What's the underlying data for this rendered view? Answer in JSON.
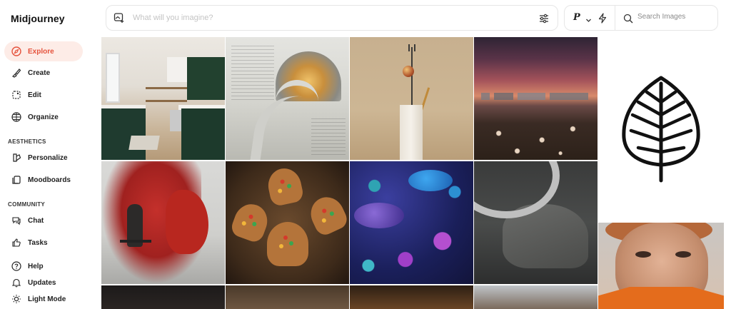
{
  "app": {
    "brand": "Midjourney"
  },
  "sidebar": {
    "items": [
      {
        "label": "Explore",
        "icon": "compass-icon",
        "active": true
      },
      {
        "label": "Create",
        "icon": "brush-icon"
      },
      {
        "label": "Edit",
        "icon": "edit-icon"
      },
      {
        "label": "Organize",
        "icon": "grid-icon"
      }
    ],
    "aesthetics_label": "AESTHETICS",
    "aesthetics_items": [
      {
        "label": "Personalize",
        "icon": "palette-icon"
      },
      {
        "label": "Moodboards",
        "icon": "moodboard-icon"
      }
    ],
    "community_label": "COMMUNITY",
    "community_items": [
      {
        "label": "Chat",
        "icon": "chat-icon"
      },
      {
        "label": "Tasks",
        "icon": "thumbs-up-icon"
      }
    ],
    "footer_items": [
      {
        "label": "Help",
        "icon": "help-icon"
      },
      {
        "label": "Updates",
        "icon": "bell-icon"
      },
      {
        "label": "Light Mode",
        "icon": "sun-icon"
      }
    ]
  },
  "prompt": {
    "placeholder": "What will you imagine?"
  },
  "tools": {
    "p_label": "P",
    "search_placeholder": "Search Images"
  },
  "colors": {
    "accent": "#e5533d",
    "accent_bg": "#fdece7"
  }
}
